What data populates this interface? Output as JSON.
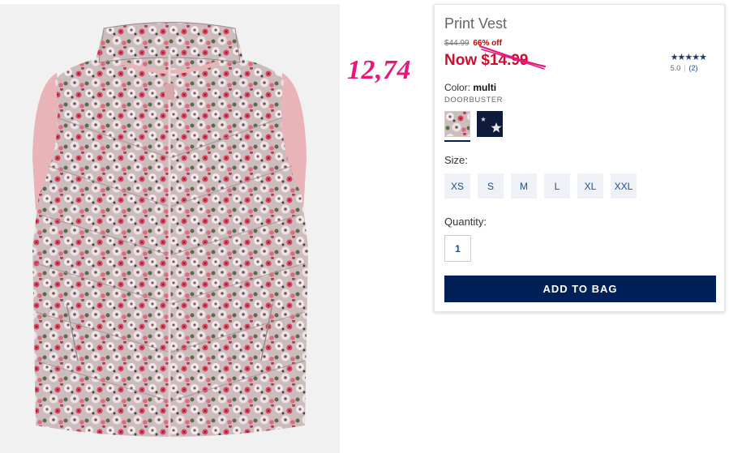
{
  "overlay": {
    "handwritten_price": "12,74"
  },
  "product": {
    "title": "Print Vest",
    "original_price": "$44.99",
    "discount": "66% off",
    "now_price": "Now $14.99",
    "rating": {
      "stars": "★★★★★",
      "score": "5.0",
      "count": "(2)"
    },
    "color": {
      "label": "Color:",
      "value": "multi",
      "badge": "DOORBUSTER"
    },
    "swatches": [
      {
        "name": "floral print",
        "selected": true
      },
      {
        "name": "navy star",
        "selected": false
      }
    ],
    "size": {
      "label": "Size:",
      "options": [
        "XS",
        "S",
        "M",
        "L",
        "XL",
        "XXL"
      ]
    },
    "quantity": {
      "label": "Quantity:",
      "value": "1"
    },
    "add_to_bag_label": "ADD TO BAG"
  },
  "colors": {
    "navy": "#002157",
    "sale_red": "#c8102e",
    "annotation_pink": "#e8157a",
    "link_blue": "#1d4f91"
  }
}
